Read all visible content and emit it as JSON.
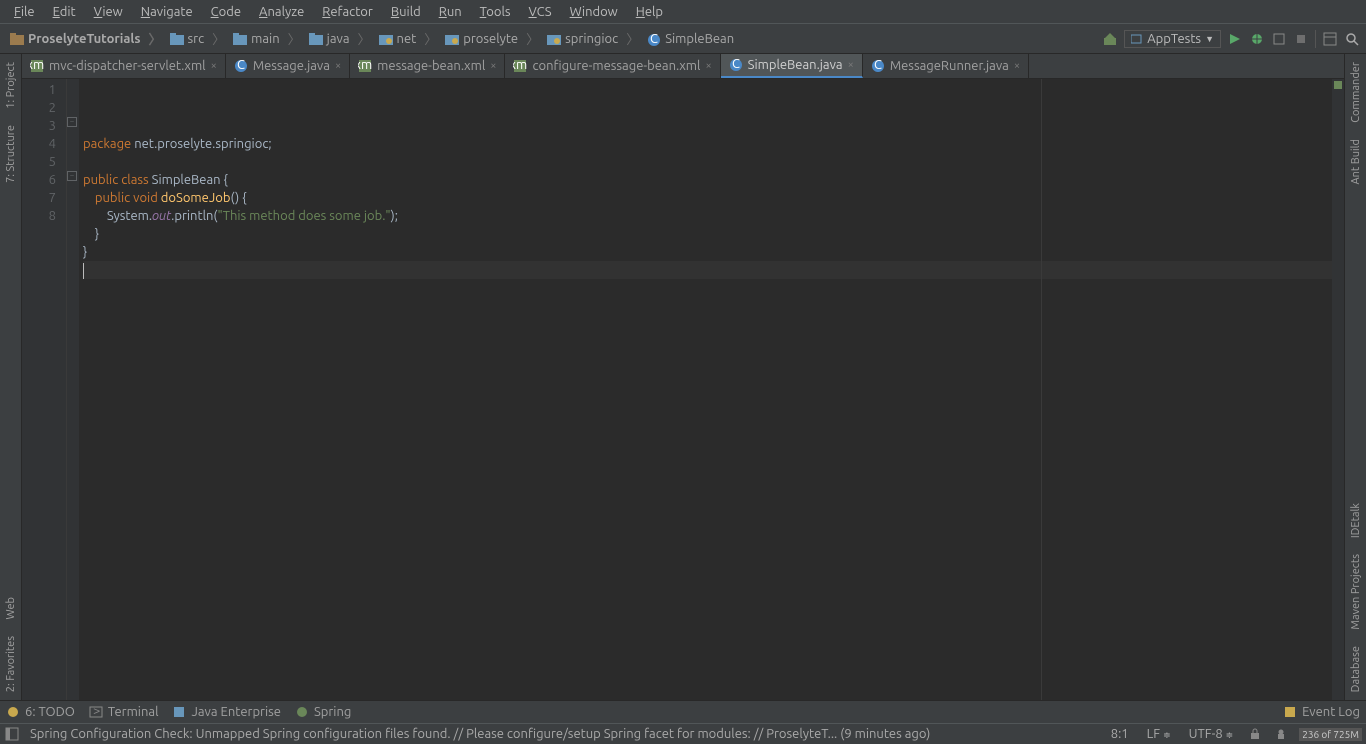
{
  "menu": [
    "File",
    "Edit",
    "View",
    "Navigate",
    "Code",
    "Analyze",
    "Refactor",
    "Build",
    "Run",
    "Tools",
    "VCS",
    "Window",
    "Help"
  ],
  "breadcrumbs": [
    {
      "label": "ProselyteTutorials",
      "kind": "proj"
    },
    {
      "label": "src",
      "kind": "folder"
    },
    {
      "label": "main",
      "kind": "folder"
    },
    {
      "label": "java",
      "kind": "folder"
    },
    {
      "label": "net",
      "kind": "pkg"
    },
    {
      "label": "proselyte",
      "kind": "pkg"
    },
    {
      "label": "springioc",
      "kind": "pkg"
    },
    {
      "label": "SimpleBean",
      "kind": "class"
    }
  ],
  "run_config": "AppTests",
  "left_tabs": [
    "1: Project",
    "7: Structure",
    "Web",
    "2: Favorites"
  ],
  "right_tabs": [
    "Commander",
    "Ant Build",
    "IDEtalk",
    "Maven Projects",
    "Database"
  ],
  "editor_tabs": [
    {
      "label": "mvc-dispatcher-servlet.xml",
      "kind": "xml"
    },
    {
      "label": "Message.java",
      "kind": "class"
    },
    {
      "label": "message-bean.xml",
      "kind": "xml"
    },
    {
      "label": "configure-message-bean.xml",
      "kind": "xml"
    },
    {
      "label": "SimpleBean.java",
      "kind": "class",
      "active": true
    },
    {
      "label": "MessageRunner.java",
      "kind": "class"
    }
  ],
  "code": {
    "lines": [
      1,
      2,
      3,
      4,
      5,
      6,
      7,
      8
    ],
    "tokens": [
      [
        {
          "t": "package ",
          "c": "kw"
        },
        {
          "t": "net.proselyte.springioc",
          "c": "cls"
        },
        {
          "t": ";",
          "c": "cls"
        }
      ],
      [],
      [
        {
          "t": "public class ",
          "c": "kw"
        },
        {
          "t": "SimpleBean {",
          "c": "cls"
        }
      ],
      [
        {
          "t": "    public void ",
          "c": "kw"
        },
        {
          "t": "doSomeJob",
          "c": "mth"
        },
        {
          "t": "() {",
          "c": "cls"
        }
      ],
      [
        {
          "t": "        System.",
          "c": "cls"
        },
        {
          "t": "out",
          "c": "fld"
        },
        {
          "t": ".println(",
          "c": "cls"
        },
        {
          "t": "\"This method does some job.\"",
          "c": "str"
        },
        {
          "t": ");",
          "c": "cls"
        }
      ],
      [
        {
          "t": "    }",
          "c": "cls"
        }
      ],
      [
        {
          "t": "}",
          "c": "cls"
        }
      ],
      []
    ]
  },
  "bottom_tools": [
    {
      "label": "6: TODO",
      "ico": "todo"
    },
    {
      "label": "Terminal",
      "ico": "term"
    },
    {
      "label": "Java Enterprise",
      "ico": "jee"
    },
    {
      "label": "Spring",
      "ico": "spring"
    }
  ],
  "event_log": "Event Log",
  "status_msg": "Spring Configuration Check: Unmapped Spring configuration files found. // Please configure/setup Spring facet for modules: // ProselyteT... (9 minutes ago)",
  "cursor": "8:1",
  "line_sep": "LF",
  "encoding": "UTF-8",
  "memory": "236 of 725M"
}
